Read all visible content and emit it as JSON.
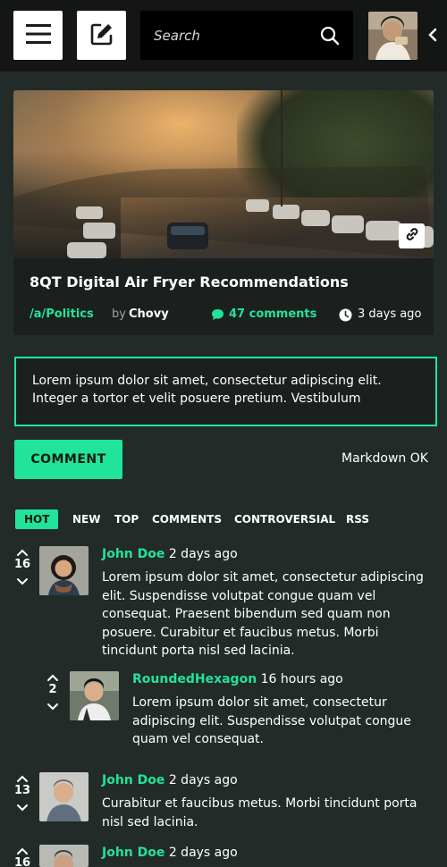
{
  "header": {
    "menu_icon": "hamburger-icon",
    "compose_icon": "edit-icon",
    "search_placeholder": "Search",
    "search_icon": "search-icon",
    "collapse_icon": "chevron-left-icon"
  },
  "post": {
    "title": "8QT Digital Air Fryer Recommendations",
    "community": "/a/Politics",
    "by_label": "by",
    "author": "Chovy",
    "comments": "47 comments",
    "age": "3 days ago",
    "link_icon": "link-icon"
  },
  "composer": {
    "text": "Lorem ipsum dolor sit amet, consectetur adipiscing elit. Integer a tortor et velit posuere pretium. Vestibulum",
    "submit_label": "COMMENT",
    "markdown_note": "Markdown OK"
  },
  "sort_tabs": [
    "HOT",
    "NEW",
    "TOP",
    "COMMENTS",
    "CONTROVERSIAL",
    "RSS"
  ],
  "comments": [
    {
      "score": "16",
      "author": "John Doe",
      "age": "2 days ago",
      "body": "Lorem ipsum dolor sit amet, consectetur adipiscing elit. Suspendisse volutpat congue quam vel consequat. Praesent bibendum sed quam non posuere. Curabitur et faucibus metus. Morbi tincidunt porta nisl sed lacinia."
    },
    {
      "score": "2",
      "author": "RoundedHexagon",
      "age": "16 hours ago",
      "body": "Lorem ipsum dolor sit amet, consectetur adipiscing elit. Suspendisse volutpat congue quam vel consequat."
    },
    {
      "score": "13",
      "author": "John Doe",
      "age": "2 days ago",
      "body": "Curabitur et faucibus metus. Morbi tincidunt porta nisl sed lacinia."
    },
    {
      "score": "16",
      "author": "John Doe",
      "age": "2 days ago",
      "body": ""
    }
  ],
  "colors": {
    "accent": "#22e39a",
    "background": "#222b28",
    "topbar": "#131614"
  }
}
